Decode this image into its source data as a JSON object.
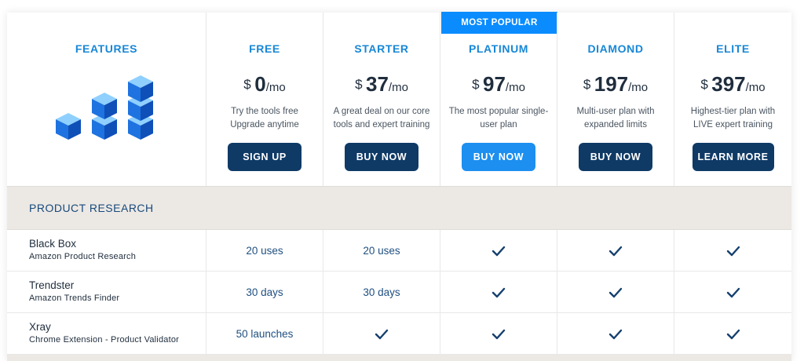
{
  "header": {
    "features_title": "FEATURES",
    "badge": "MOST POPULAR",
    "plans": [
      {
        "name": "FREE",
        "currency": "$",
        "amount": "0",
        "period": "/mo",
        "desc1": "Try the tools free",
        "desc2": "Upgrade anytime",
        "button": "SIGN UP",
        "button_style": "navy"
      },
      {
        "name": "STARTER",
        "currency": "$",
        "amount": "37",
        "period": "/mo",
        "desc1": "A great deal on our core",
        "desc2": "tools and expert training",
        "button": "BUY NOW",
        "button_style": "navy"
      },
      {
        "name": "PLATINUM",
        "currency": "$",
        "amount": "97",
        "period": "/mo",
        "desc1": "The most popular single-",
        "desc2": "user plan",
        "button": "BUY NOW",
        "button_style": "blue"
      },
      {
        "name": "DIAMOND",
        "currency": "$",
        "amount": "197",
        "period": "/mo",
        "desc1": "Multi-user plan with",
        "desc2": "expanded limits",
        "button": "BUY NOW",
        "button_style": "navy"
      },
      {
        "name": "ELITE",
        "currency": "$",
        "amount": "397",
        "period": "/mo",
        "desc1": "Highest-tier plan with",
        "desc2": "LIVE expert training",
        "button": "LEARN MORE",
        "button_style": "navy"
      }
    ]
  },
  "section": {
    "title": "PRODUCT RESEARCH"
  },
  "features": [
    {
      "name": "Black Box",
      "sub": "Amazon Product Research",
      "values": [
        "20 uses",
        "20 uses",
        "check",
        "check",
        "check"
      ]
    },
    {
      "name": "Trendster",
      "sub": "Amazon Trends Finder",
      "values": [
        "30 days",
        "30 days",
        "check",
        "check",
        "check"
      ]
    },
    {
      "name": "Xray",
      "sub": "Chrome Extension - Product Validator",
      "values": [
        "50 launches",
        "check",
        "check",
        "check",
        "check"
      ]
    }
  ],
  "colors": {
    "accent": "#1787d6",
    "navy": "#0f3a66",
    "popular": "#0a8cff",
    "section_bg": "#ece8e4"
  },
  "icons": {
    "features_illustration": "stacked-cubes-icon",
    "included": "check-icon"
  }
}
